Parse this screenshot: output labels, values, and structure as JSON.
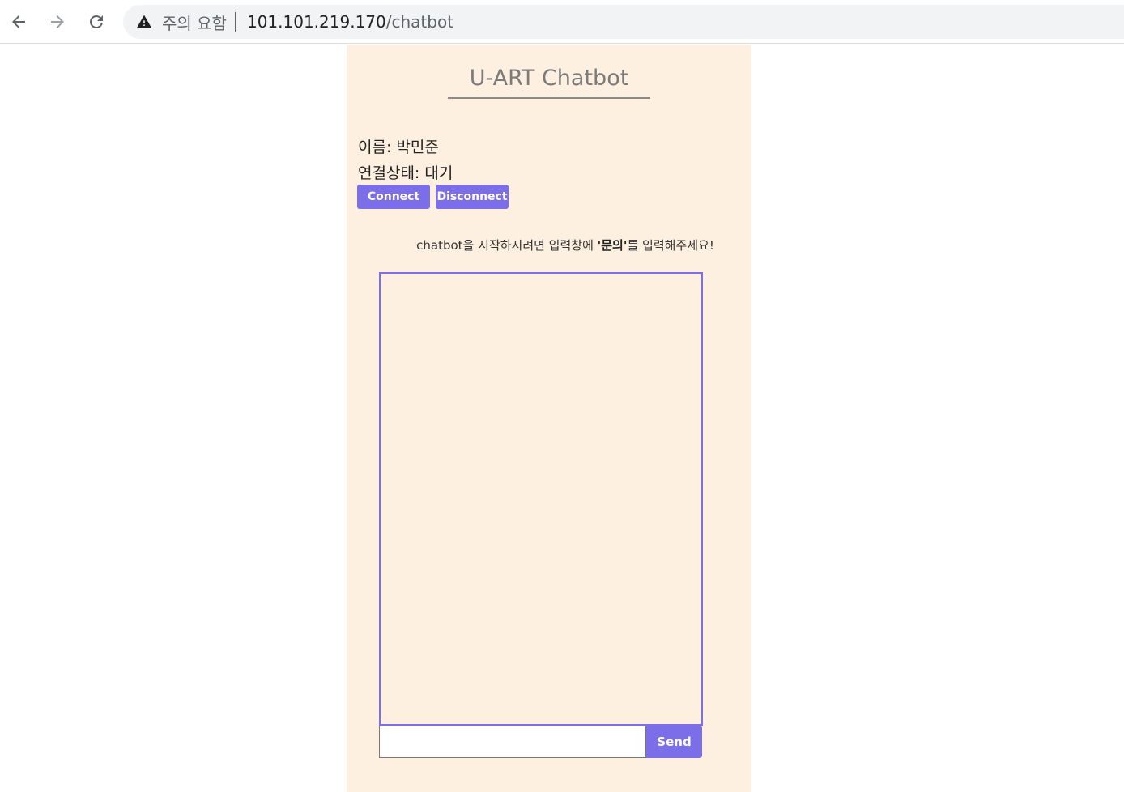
{
  "browser": {
    "security_warning": "주의 요함",
    "url_host": "101.101.219.170",
    "url_path": "/chatbot"
  },
  "page": {
    "title": "U-ART Chatbot",
    "name_label": "이름:",
    "name_value": "박민준",
    "status_label": "연결상태:",
    "status_value": "대기",
    "connect_label": "Connect",
    "disconnect_label": "Disconnect",
    "instruction_prefix": "chatbot을 시작하시려면 입력창에 ",
    "instruction_keyword": "'문의'",
    "instruction_suffix": "를 입력해주세요!",
    "message_input_value": "",
    "send_label": "Send"
  },
  "colors": {
    "accent": "#7b6ee8",
    "panel_bg": "#fdf0e1"
  }
}
